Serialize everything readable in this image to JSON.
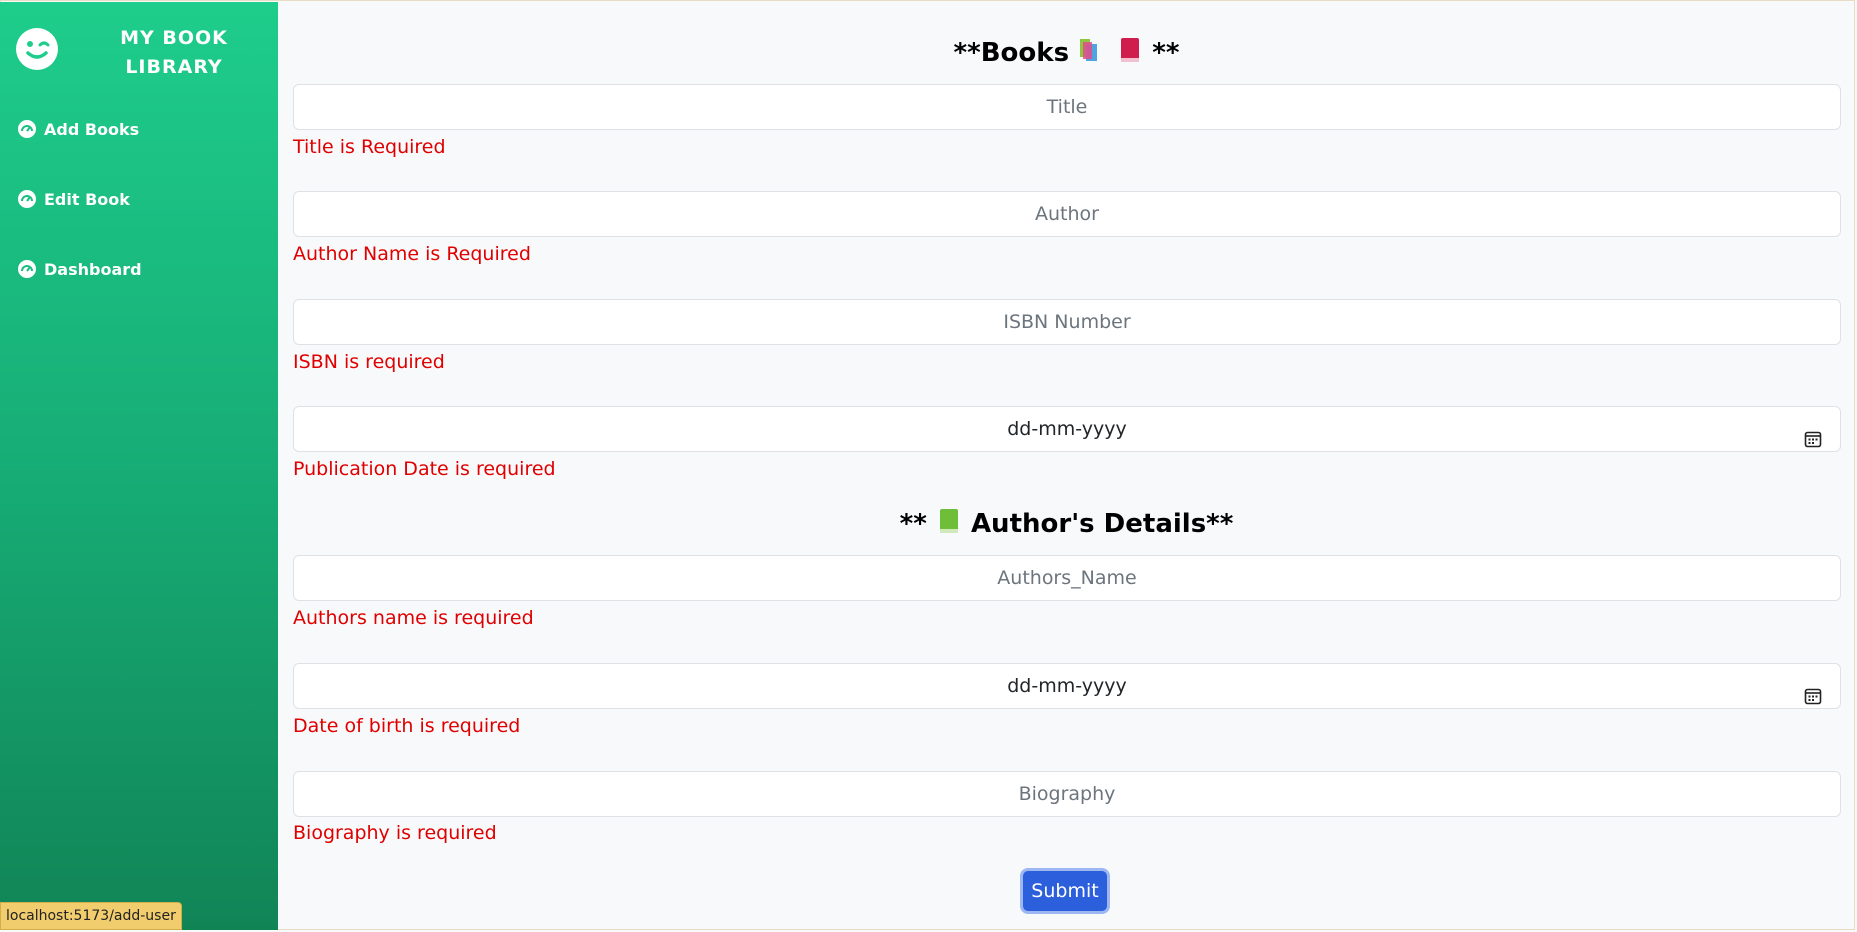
{
  "sidebar": {
    "brand_title": "MY BOOK LIBRARY",
    "items": [
      {
        "label": "Add Books",
        "icon": "dashboard-icon"
      },
      {
        "label": "Edit Book",
        "icon": "dashboard-icon"
      },
      {
        "label": "Dashboard",
        "icon": "dashboard-icon"
      }
    ]
  },
  "books_section": {
    "title_prefix": "**Books ",
    "title_suffix": "**",
    "fields": [
      {
        "placeholder": "Title",
        "error": "Title is Required"
      },
      {
        "placeholder": "Author",
        "error": "Author Name is Required"
      },
      {
        "placeholder": "ISBN Number",
        "error": "ISBN is required"
      },
      {
        "value": "dd-mm-yyyy",
        "error": "Publication Date is required"
      }
    ]
  },
  "author_section": {
    "title_prefix": "** ",
    "title_suffix": " Author's Details**",
    "fields": [
      {
        "placeholder": "Authors_Name",
        "error": "Authors name is required"
      },
      {
        "value": "dd-mm-yyyy",
        "error": "Date of birth is required"
      },
      {
        "placeholder": "Biography",
        "error": "Biography is required"
      }
    ]
  },
  "submit_label": "Submit",
  "status_url": "localhost:5173/add-user",
  "colors": {
    "sidebar_top": "#1ecd8b",
    "sidebar_bottom": "#118456",
    "error": "#e00000",
    "submit": "#2b5fdc"
  }
}
